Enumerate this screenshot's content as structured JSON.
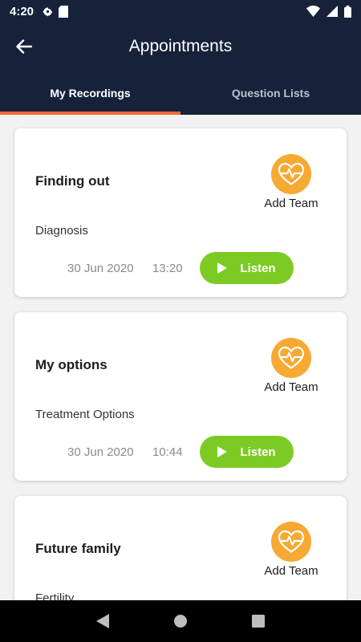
{
  "status_bar": {
    "time": "4:20"
  },
  "header": {
    "title": "Appointments",
    "back_icon": "arrow-left-icon"
  },
  "tabs": [
    {
      "label": "My Recordings",
      "active": true
    },
    {
      "label": "Question Lists",
      "active": false
    }
  ],
  "colors": {
    "header_bg": "#17223a",
    "tab_indicator": "#f26a3b",
    "team_icon_bg": "#f7a932",
    "listen_button": "#7ccb24"
  },
  "recordings": [
    {
      "title": "Finding out",
      "subtitle": "Diagnosis",
      "team_label": "Add Team",
      "date": "30 Jun 2020",
      "time": "13:20",
      "listen_label": "Listen"
    },
    {
      "title": "My options",
      "subtitle": "Treatment Options",
      "team_label": "Add Team",
      "date": "30 Jun 2020",
      "time": "10:44",
      "listen_label": "Listen"
    },
    {
      "title": "Future family",
      "subtitle": "Fertility",
      "team_label": "Add Team",
      "date": "",
      "time": "",
      "listen_label": ""
    }
  ]
}
